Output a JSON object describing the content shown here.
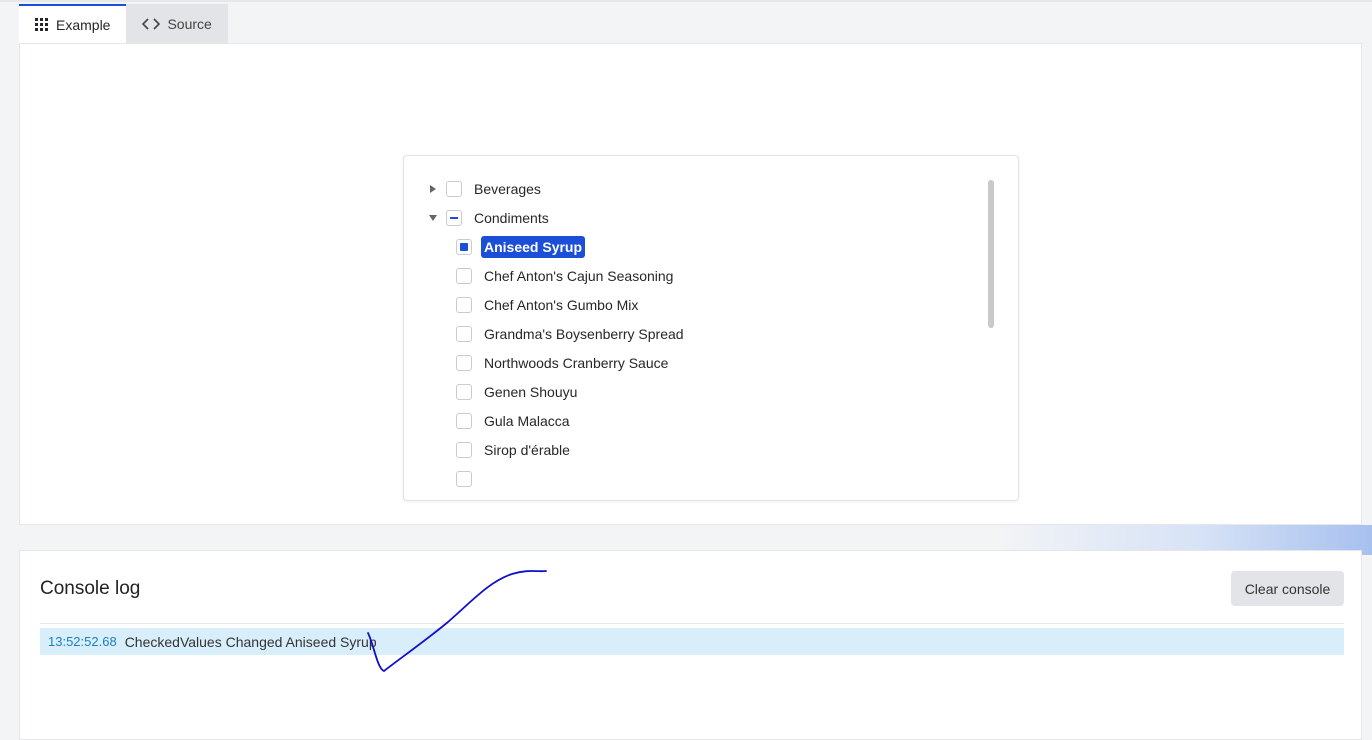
{
  "tabs": [
    {
      "label": "Example",
      "icon": "grid-icon",
      "active": true
    },
    {
      "label": "Source",
      "icon": "code-icon",
      "active": false
    }
  ],
  "tree": {
    "nodes": [
      {
        "label": "Beverages",
        "expanded": false,
        "check_state": "unchecked"
      },
      {
        "label": "Condiments",
        "expanded": true,
        "check_state": "indeterminate",
        "children": [
          {
            "label": "Aniseed Syrup",
            "check_state": "checked",
            "selected": true
          },
          {
            "label": "Chef Anton's Cajun Seasoning",
            "check_state": "unchecked"
          },
          {
            "label": "Chef Anton's Gumbo Mix",
            "check_state": "unchecked"
          },
          {
            "label": "Grandma's Boysenberry Spread",
            "check_state": "unchecked"
          },
          {
            "label": "Northwoods Cranberry Sauce",
            "check_state": "unchecked"
          },
          {
            "label": "Genen Shouyu",
            "check_state": "unchecked"
          },
          {
            "label": "Gula Malacca",
            "check_state": "unchecked"
          },
          {
            "label": "Sirop d'érable",
            "check_state": "unchecked"
          }
        ]
      }
    ]
  },
  "console": {
    "title": "Console log",
    "clear_label": "Clear console",
    "entries": [
      {
        "time": "13:52:52.68",
        "message": "CheckedValues Changed Aniseed Syrup"
      }
    ]
  },
  "colors": {
    "accent": "#1c4fd8",
    "log_row_bg": "#d8effb",
    "log_time": "#1e7fbf",
    "annotation_stroke": "#1010c8"
  }
}
